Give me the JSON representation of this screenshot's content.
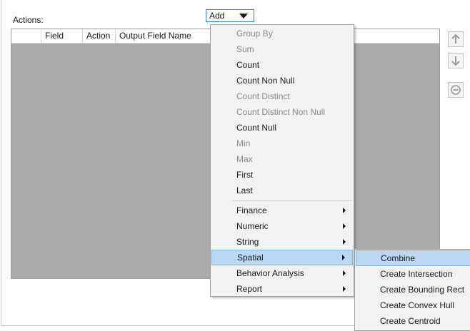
{
  "actions_label": "Actions:",
  "add_dropdown": {
    "label": "Add"
  },
  "grid": {
    "columns": [
      "",
      "Field",
      "Action",
      "Output Field Name"
    ]
  },
  "menu": {
    "items": [
      {
        "label": "Group By",
        "enabled": false
      },
      {
        "label": "Sum",
        "enabled": false
      },
      {
        "label": "Count",
        "enabled": true
      },
      {
        "label": "Count Non Null",
        "enabled": true
      },
      {
        "label": "Count Distinct",
        "enabled": false
      },
      {
        "label": "Count Distinct Non Null",
        "enabled": false
      },
      {
        "label": "Count Null",
        "enabled": true
      },
      {
        "label": "Min",
        "enabled": false
      },
      {
        "label": "Max",
        "enabled": false
      },
      {
        "label": "First",
        "enabled": true
      },
      {
        "label": "Last",
        "enabled": true
      }
    ],
    "submenus": [
      {
        "label": "Finance"
      },
      {
        "label": "Numeric"
      },
      {
        "label": "String"
      },
      {
        "label": "Spatial"
      },
      {
        "label": "Behavior Analysis"
      },
      {
        "label": "Report"
      }
    ]
  },
  "spatial_submenu": {
    "items": [
      "Combine",
      "Create Intersection",
      "Create Bounding Rect",
      "Create Convex Hull",
      "Create Centroid"
    ]
  },
  "side_buttons": [
    "move-up-icon",
    "move-down-icon",
    "remove-icon"
  ],
  "colors": {
    "highlight": "#bcd7f2",
    "highlight_border": "#7fb3e6",
    "grid_bg": "#ababab",
    "dropdown_border": "#2b7bd1"
  }
}
